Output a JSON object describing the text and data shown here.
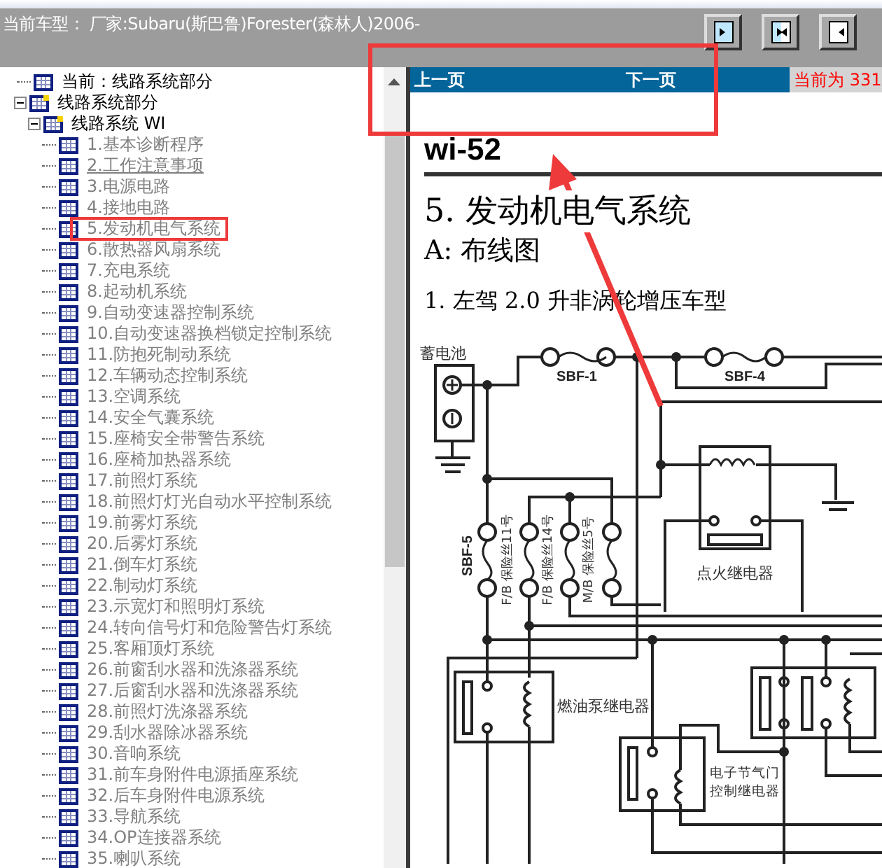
{
  "header": {
    "title": "当前车型： 厂家:Subaru(斯巴鲁)Forester(森林人)2006-",
    "buttons": [
      {
        "kind": "right"
      },
      {
        "kind": "both"
      },
      {
        "kind": "left"
      }
    ]
  },
  "tree": [
    {
      "label": "当前：线路系统部分"
    },
    {
      "label": "线路系统部分",
      "expanded": true,
      "children": [
        {
          "label": "线路系统 WI",
          "expanded": true,
          "children": [
            {
              "label": "1.基本诊断程序",
              "hovered": false
            },
            {
              "label": "2.工作注意事项",
              "hovered": true
            },
            {
              "label": "3.电源电路",
              "hovered": false
            },
            {
              "label": "4.接地电路",
              "hovered": false
            },
            {
              "label": "5.发动机电气系统",
              "hovered": false
            },
            {
              "label": "6.散热器风扇系统",
              "hovered": false
            },
            {
              "label": "7.充电系统",
              "hovered": false
            },
            {
              "label": "8.起动机系统",
              "hovered": false
            },
            {
              "label": "9.自动变速器控制系统",
              "hovered": false
            },
            {
              "label": "10.自动变速器换档锁定控制系统",
              "hovered": false
            },
            {
              "label": "11.防抱死制动系统",
              "hovered": false
            },
            {
              "label": "12.车辆动态控制系统",
              "hovered": false
            },
            {
              "label": "13.空调系统",
              "hovered": false
            },
            {
              "label": "14.安全气囊系统",
              "hovered": false
            },
            {
              "label": "15.座椅安全带警告系统",
              "hovered": false
            },
            {
              "label": "16.座椅加热器系统",
              "hovered": false
            },
            {
              "label": "17.前照灯系统",
              "hovered": false
            },
            {
              "label": "18.前照灯灯光自动水平控制系统",
              "hovered": false
            },
            {
              "label": "19.前雾灯系统",
              "hovered": false
            },
            {
              "label": "20.后雾灯系统",
              "hovered": false
            },
            {
              "label": "21.倒车灯系统",
              "hovered": false
            },
            {
              "label": "22.制动灯系统",
              "hovered": false
            },
            {
              "label": "23.示宽灯和照明灯系统",
              "hovered": false
            },
            {
              "label": "24.转向信号灯和危险警告灯系统",
              "hovered": false
            },
            {
              "label": "25.客厢顶灯系统",
              "hovered": false
            },
            {
              "label": "26.前窗刮水器和洗涤器系统",
              "hovered": false
            },
            {
              "label": "27.后窗刮水器和洗涤器系统",
              "hovered": false
            },
            {
              "label": "28.前照灯洗涤器系统",
              "hovered": false
            },
            {
              "label": "29.刮水器除冰器系统",
              "hovered": false
            },
            {
              "label": "30.音响系统",
              "hovered": false
            },
            {
              "label": "31.前车身附件电源插座系统",
              "hovered": false
            },
            {
              "label": "32.后车身附件电源系统",
              "hovered": false
            },
            {
              "label": "33.导航系统",
              "hovered": false
            },
            {
              "label": "34.OP连接器系统",
              "hovered": false
            },
            {
              "label": "35.喇叭系统",
              "hovered": false
            }
          ]
        }
      ]
    }
  ],
  "nav": {
    "prev": "上一页",
    "next": "下一页",
    "current": "当前为 331"
  },
  "page": {
    "code": "wi-52",
    "heading": "5. 发动机电气系统",
    "subheading": "A: 布线图",
    "caption": "1. 左驾 2.0 升非涡轮增压车型",
    "diagram": {
      "battery": "蓄电池",
      "fuses": [
        "SBF-1",
        "SBF-4",
        "SBF-5"
      ],
      "fuse_boxes": [
        "F/B 保险丝11号",
        "F/B 保险丝14号",
        "M/B 保险丝5号"
      ],
      "ignition_relay": "点火继电器",
      "fuel_pump_relay": "燃油泵继电器",
      "etc_relay": [
        "电子节气门",
        "控制继电器"
      ]
    }
  }
}
